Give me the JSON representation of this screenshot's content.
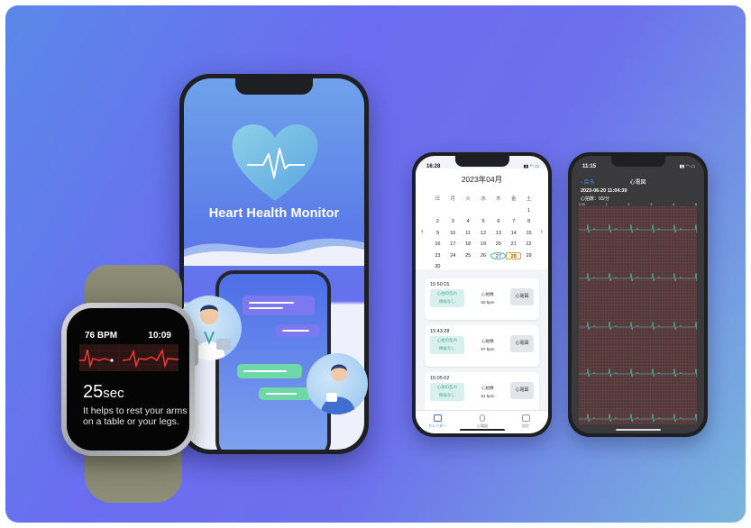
{
  "colors": {
    "bg_start": "#5a88e8",
    "bg_end": "#79b6dc",
    "accent": "#3fb2a8",
    "ecg_red": "#e0322b"
  },
  "hero_phone": {
    "title": "Heart Health Monitor",
    "icon": "heart-ecg-icon"
  },
  "watch": {
    "bpm": "76 BPM",
    "time": "10:09",
    "seconds_value": "25",
    "seconds_unit": "sec",
    "message": "It helps to rest your arms on a table or your legs."
  },
  "calendar_phone": {
    "status_time": "16:28",
    "month": "2023年04月",
    "weekdays": [
      "日",
      "月",
      "火",
      "水",
      "木",
      "金",
      "土"
    ],
    "weeks": [
      [
        "",
        "",
        "",
        "",
        "",
        "",
        "1"
      ],
      [
        "2",
        "3",
        "4",
        "5",
        "6",
        "7",
        "8"
      ],
      [
        "9",
        "10",
        "11",
        "12",
        "13",
        "14",
        "15"
      ],
      [
        "16",
        "17",
        "18",
        "19",
        "20",
        "21",
        "22"
      ],
      [
        "23",
        "24",
        "25",
        "26",
        "27",
        "28",
        "29"
      ],
      [
        "30",
        "",
        "",
        "",
        "",
        "",
        ""
      ]
    ],
    "records": [
      {
        "time": "15:50:15",
        "tag1": "心拍の乱れ",
        "tag2": "徴候なし",
        "hr_label": "心拍数",
        "hr_value": "60 bpm",
        "button": "心電図"
      },
      {
        "time": "15:43:28",
        "tag1": "心拍の乱れ",
        "tag2": "徴候なし",
        "hr_label": "心拍数",
        "hr_value": "57 bpm",
        "button": "心電図"
      },
      {
        "time": "15:05:02",
        "tag1": "心拍の乱れ",
        "tag2": "徴候なし",
        "hr_label": "心拍数",
        "hr_value": "51 bpm",
        "button": "心電図"
      }
    ],
    "tabs": [
      "カレンダー",
      "心電図",
      "設定"
    ]
  },
  "ecg_phone": {
    "status_time": "11:15",
    "back_label": "‹ 戻る",
    "title": "心電図",
    "datetime": "2023-06-20 11:04:39",
    "heart_rate": "心拍数：93/分",
    "scale_labels": [
      "0.00",
      "1",
      "2",
      "3",
      "4",
      "5"
    ]
  }
}
